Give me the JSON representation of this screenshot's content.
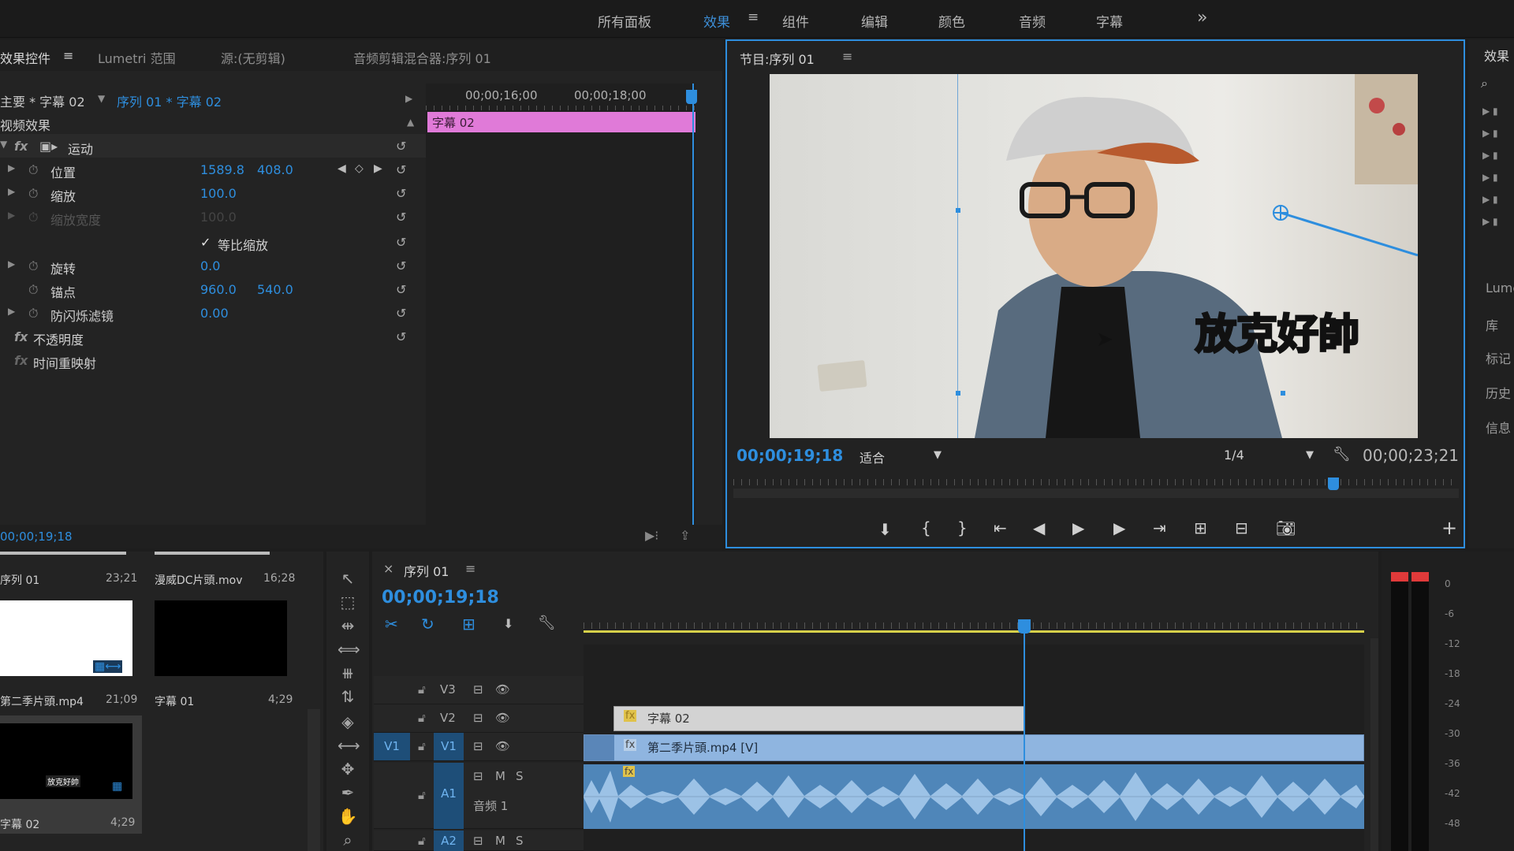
{
  "workspaces": {
    "items": [
      "所有面板",
      "效果",
      "组件",
      "编辑",
      "颜色",
      "音频",
      "字幕"
    ],
    "active": "效果",
    "overflow": "»"
  },
  "effect_controls": {
    "tabs": [
      "效果控件",
      "Lumetri 范围",
      "源:(无剪辑)",
      "音频剪辑混合器:序列 01"
    ],
    "master_label": "主要 * 字幕 02",
    "sequence_label": "序列 01 * 字幕 02",
    "ruler_times": [
      "00;00;16;00",
      "00;00;18;00"
    ],
    "clip_label": "字幕 02",
    "section_video": "视频效果",
    "motion": "运动",
    "props": {
      "position": {
        "label": "位置",
        "v1": "1589.8",
        "v2": "408.0"
      },
      "scale": {
        "label": "缩放",
        "v1": "100.0"
      },
      "scale_width": {
        "label": "缩放宽度",
        "v1": "100.0"
      },
      "uniform": "等比缩放",
      "rotation": {
        "label": "旋转",
        "v1": "0.0"
      },
      "anchor": {
        "label": "锚点",
        "v1": "960.0",
        "v2": "540.0"
      },
      "flicker": {
        "label": "防闪烁滤镜",
        "v1": "0.00"
      }
    },
    "opacity": "不透明度",
    "time_remap": "时间重映射",
    "timecode": "00;00;19;18"
  },
  "program_monitor": {
    "title": "节目:序列 01",
    "caption": "放克好帥",
    "timecode": "00;00;19;18",
    "fit": "适合",
    "resolution": "1/4",
    "duration": "00;00;23;21"
  },
  "project": {
    "items": [
      {
        "name": "序列 01",
        "duration": "23;21"
      },
      {
        "name": "漫威DC片頭.mov",
        "duration": "16;28"
      },
      {
        "name": "第二季片頭.mp4",
        "duration": "21;09"
      },
      {
        "name": "字幕 01",
        "duration": "4;29"
      },
      {
        "name": "字幕 02",
        "duration": "4;29"
      }
    ],
    "thumb_caption": "放克好帥"
  },
  "timeline": {
    "tab_title": "序列 01",
    "timecode": "00;00;19;18",
    "tracks": {
      "v3": "V3",
      "v2": "V2",
      "v1": "V1",
      "v1_src": "V1",
      "a1": "A1",
      "a1_name": "音频 1",
      "a2": "A2"
    },
    "clip_title": "字幕 02",
    "clip_video": "第二季片頭.mp4 [V]"
  },
  "vu_meter": {
    "labels": [
      "0",
      "-6",
      "-12",
      "-18",
      "-24",
      "-30",
      "-36",
      "-42",
      "-48"
    ]
  },
  "right_panel": {
    "title": "效果",
    "items": [
      "Lume",
      "库",
      "标记",
      "历史",
      "信息"
    ]
  },
  "colors": {
    "accent": "#2e8ede",
    "title_clip": "#e07ad8",
    "video_clip": "#8fb5e0",
    "audio_clip": "#4f86b9"
  }
}
